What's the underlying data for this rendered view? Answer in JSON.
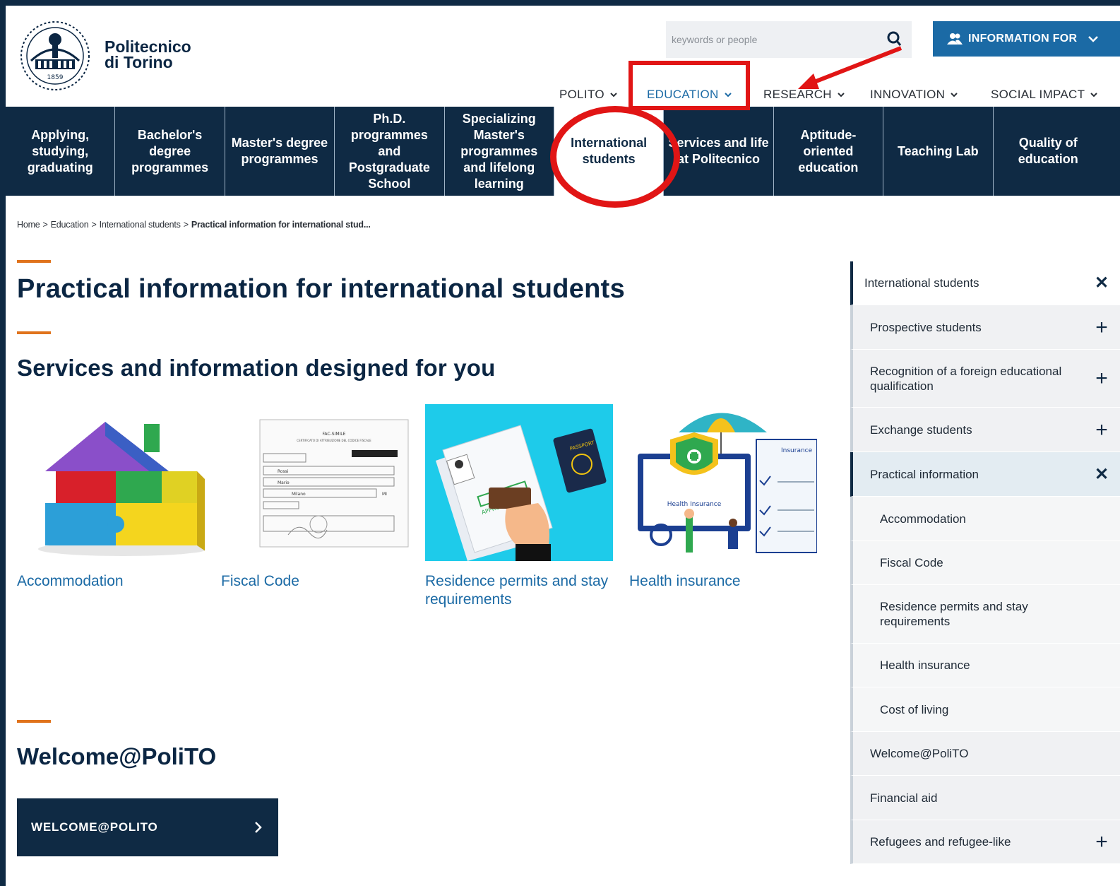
{
  "header": {
    "logo_line1": "Politecnico",
    "logo_line2": "di Torino",
    "logo_year": "1859",
    "search_placeholder": "keywords or people",
    "info_button": "INFORMATION FOR"
  },
  "topnav": [
    {
      "label": "POLITO",
      "active": false
    },
    {
      "label": "EDUCATION",
      "active": true
    },
    {
      "label": "RESEARCH",
      "active": false
    },
    {
      "label": "INNOVATION",
      "active": false
    },
    {
      "label": "SOCIAL IMPACT",
      "active": false
    }
  ],
  "subnav": [
    "Applying, studying, graduating",
    "Bachelor's degree programmes",
    "Master's degree programmes",
    "Ph.D. programmes and Postgraduate School",
    "Specializing Master's programmes and lifelong learning",
    "International students",
    "Services and life at Politecnico",
    "Aptitude-oriented education",
    "Teaching Lab",
    "Quality of education"
  ],
  "breadcrumb": {
    "home": "Home",
    "sep": ">",
    "education": "Education",
    "international": "International students",
    "current": "Practical information for international stud..."
  },
  "main": {
    "title": "Practical information for international students",
    "subtitle": "Services and information designed for you",
    "cards": [
      {
        "label": "Accommodation"
      },
      {
        "label": "Fiscal Code"
      },
      {
        "label": "Residence permits and stay requirements"
      },
      {
        "label": "Health insurance"
      }
    ],
    "fiscal_doc_header": "FAC-SIMILE",
    "fiscal_doc_sub": "CERTIFICATO DI ATTRIBUZIONE DEL CODICE FISCALE",
    "fiscal_doc_name1": "Rossi",
    "fiscal_doc_name2": "Mario",
    "fiscal_doc_city": "Milano",
    "fiscal_doc_prov": "MI",
    "passport_text": "PASSPORT",
    "stamp_text": "APPROVED",
    "health_screen_text": "Health Insurance",
    "clipboard_title": "Insurance",
    "welcome_heading": "Welcome@PoliTO",
    "welcome_button": "WELCOME@POLITO"
  },
  "sidebar": {
    "items": [
      {
        "label": "International students",
        "icon": "close-icon"
      },
      {
        "label": "Prospective students",
        "icon": "plus-icon"
      },
      {
        "label": "Recognition of a foreign educational qualification",
        "icon": "plus-icon"
      },
      {
        "label": "Exchange students",
        "icon": "plus-icon"
      },
      {
        "label": "Practical information",
        "icon": "close-icon"
      },
      {
        "label": "Accommodation"
      },
      {
        "label": "Fiscal Code"
      },
      {
        "label": "Residence permits and stay requirements"
      },
      {
        "label": "Health insurance"
      },
      {
        "label": "Cost of living"
      },
      {
        "label": "Welcome@PoliTO"
      },
      {
        "label": "Financial aid"
      },
      {
        "label": "Refugees and refugee-like",
        "icon": "plus-icon"
      }
    ]
  },
  "colors": {
    "navy": "#0f2a44",
    "link_blue": "#1b6aa5",
    "accent_orange": "#e0731c",
    "annotation_red": "#e11515"
  }
}
